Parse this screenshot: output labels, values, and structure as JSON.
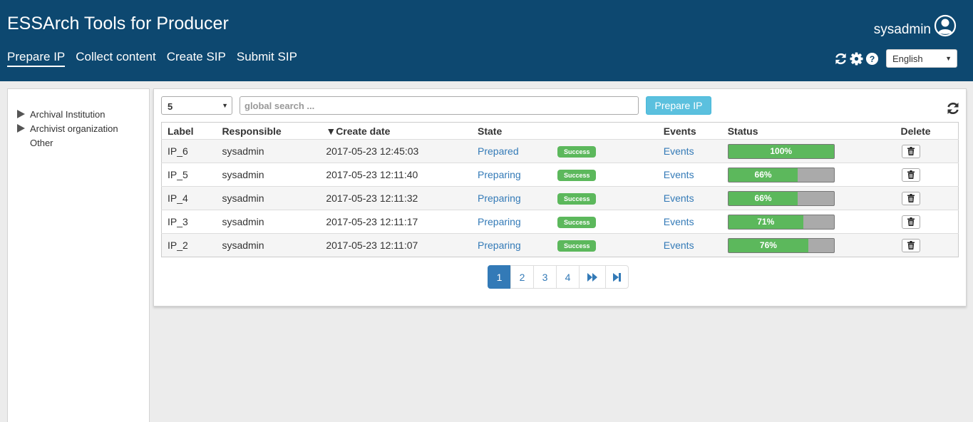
{
  "app": {
    "title": "ESSArch Tools for Producer"
  },
  "nav": [
    {
      "label": "Prepare IP",
      "active": true
    },
    {
      "label": "Collect content",
      "active": false
    },
    {
      "label": "Create SIP",
      "active": false
    },
    {
      "label": "Submit SIP",
      "active": false
    }
  ],
  "user": {
    "name": "sysadmin"
  },
  "header_tools": [
    "refresh-icon",
    "gear-icon",
    "help-icon"
  ],
  "language": {
    "selected": "English"
  },
  "sidebar": {
    "items": [
      {
        "label": "Archival Institution",
        "expandable": true
      },
      {
        "label": "Archivist organization",
        "expandable": true
      },
      {
        "label": "Other",
        "expandable": false
      }
    ]
  },
  "toolbar": {
    "page_size": "5",
    "search_placeholder": "global search ...",
    "prepare_label": "Prepare IP"
  },
  "table": {
    "headers": {
      "label": "Label",
      "responsible": "Responsible",
      "create_date": "Create date",
      "sort_indicator": "▼",
      "state": "State",
      "events": "Events",
      "status": "Status",
      "delete": "Delete"
    },
    "rows": [
      {
        "label": "IP_6",
        "responsible": "sysadmin",
        "create_date": "2017-05-23 12:45:03",
        "state": "Prepared",
        "badge": "Success",
        "events": "Events",
        "progress": 100,
        "progress_label": "100%"
      },
      {
        "label": "IP_5",
        "responsible": "sysadmin",
        "create_date": "2017-05-23 12:11:40",
        "state": "Preparing",
        "badge": "Success",
        "events": "Events",
        "progress": 66,
        "progress_label": "66%"
      },
      {
        "label": "IP_4",
        "responsible": "sysadmin",
        "create_date": "2017-05-23 12:11:32",
        "state": "Preparing",
        "badge": "Success",
        "events": "Events",
        "progress": 66,
        "progress_label": "66%"
      },
      {
        "label": "IP_3",
        "responsible": "sysadmin",
        "create_date": "2017-05-23 12:11:17",
        "state": "Preparing",
        "badge": "Success",
        "events": "Events",
        "progress": 71,
        "progress_label": "71%"
      },
      {
        "label": "IP_2",
        "responsible": "sysadmin",
        "create_date": "2017-05-23 12:11:07",
        "state": "Preparing",
        "badge": "Success",
        "events": "Events",
        "progress": 76,
        "progress_label": "76%"
      }
    ]
  },
  "pagination": {
    "pages": [
      "1",
      "2",
      "3",
      "4"
    ],
    "active": "1",
    "next_icon": "fast-forward-icon",
    "last_icon": "last-page-icon"
  },
  "colors": {
    "header_bg": "#0d4870",
    "link": "#337ab7",
    "success": "#5cb85c",
    "info_button": "#5bc0de"
  }
}
